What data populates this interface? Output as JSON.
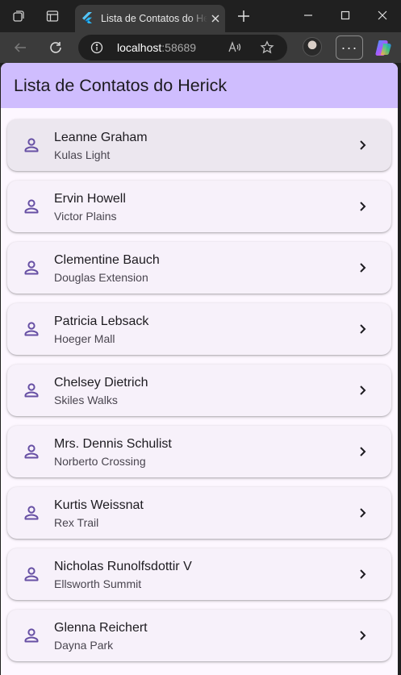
{
  "browser": {
    "tab_title": "Lista de Contatos do Herick",
    "url_host": "localhost",
    "url_port": ":58689",
    "menu_label": "···"
  },
  "app": {
    "title": "Lista de Contatos do Herick",
    "accent_color": "#6750a4",
    "appbar_color": "#cfbdfe"
  },
  "contacts": [
    {
      "name": "Leanne Graham",
      "street": "Kulas Light"
    },
    {
      "name": "Ervin Howell",
      "street": "Victor Plains"
    },
    {
      "name": "Clementine Bauch",
      "street": "Douglas Extension"
    },
    {
      "name": "Patricia Lebsack",
      "street": "Hoeger Mall"
    },
    {
      "name": "Chelsey Dietrich",
      "street": "Skiles Walks"
    },
    {
      "name": "Mrs. Dennis Schulist",
      "street": "Norberto Crossing"
    },
    {
      "name": "Kurtis Weissnat",
      "street": "Rex Trail"
    },
    {
      "name": "Nicholas Runolfsdottir V",
      "street": "Ellsworth Summit"
    },
    {
      "name": "Glenna Reichert",
      "street": "Dayna Park"
    }
  ],
  "icons": {
    "contact": "person-outline-icon",
    "trailing": "chevron-right-icon"
  }
}
